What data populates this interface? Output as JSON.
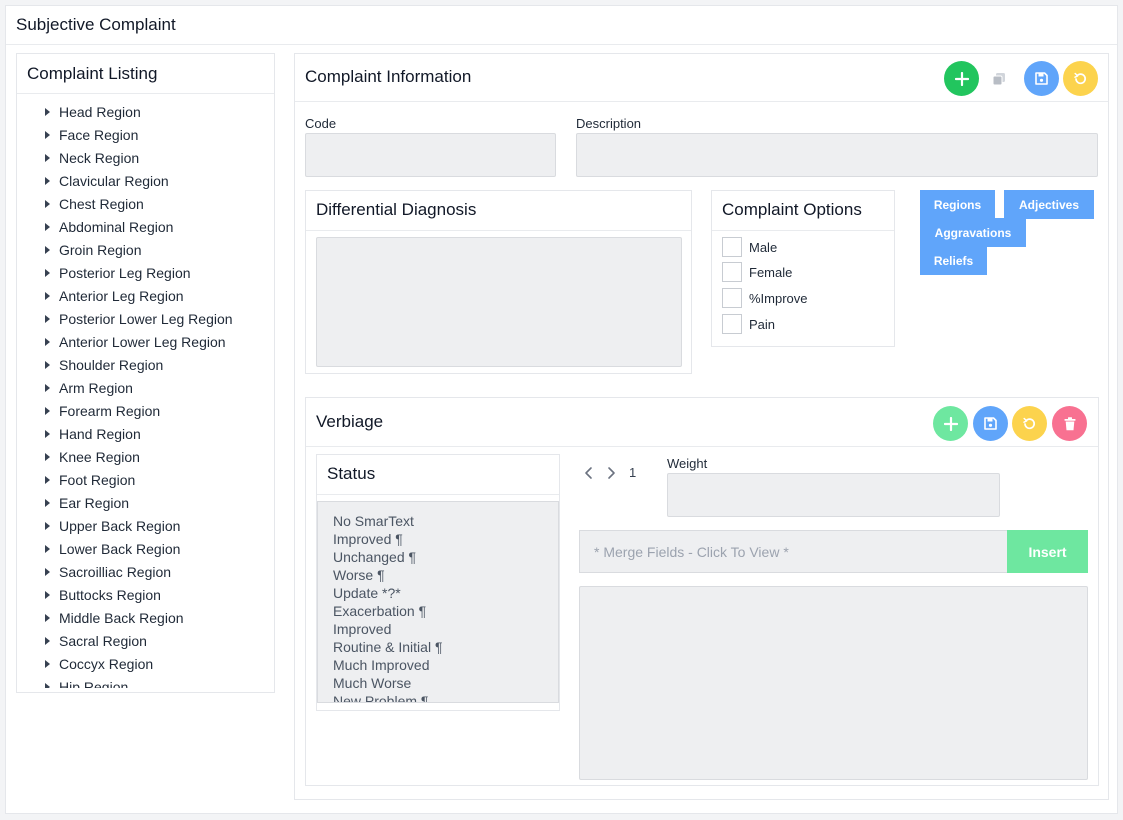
{
  "page": {
    "title": "Subjective Complaint"
  },
  "listing": {
    "title": "Complaint Listing",
    "items": [
      "Head Region",
      "Face Region",
      "Neck Region",
      "Clavicular Region",
      "Chest Region",
      "Abdominal Region",
      "Groin Region",
      "Posterior Leg Region",
      "Anterior Leg Region",
      "Posterior Lower Leg Region",
      "Anterior Lower Leg Region",
      "Shoulder Region",
      "Arm Region",
      "Forearm Region",
      "Hand Region",
      "Knee Region",
      "Foot Region",
      "Ear Region",
      "Upper Back Region",
      "Lower Back Region",
      "Sacroilliac Region",
      "Buttocks Region",
      "Middle Back Region",
      "Sacral Region",
      "Coccyx Region",
      "Hip Region"
    ]
  },
  "info": {
    "title": "Complaint Information",
    "code_label": "Code",
    "code_value": "",
    "description_label": "Description",
    "description_value": ""
  },
  "differential": {
    "title": "Differential Diagnosis",
    "value": ""
  },
  "options": {
    "title": "Complaint Options",
    "items": [
      "Male",
      "Female",
      "%Improve",
      "Pain"
    ]
  },
  "tag_buttons": {
    "regions": "Regions",
    "adjectives": "Adjectives",
    "aggravations": "Aggravations",
    "reliefs": "Reliefs"
  },
  "verbiage": {
    "title": "Verbiage",
    "status_title": "Status",
    "status_items": [
      "No SmarText",
      "Improved ¶",
      "Unchanged ¶",
      "Worse ¶",
      "Update *?*",
      "Exacerbation ¶",
      "Improved",
      "Routine & Initial ¶",
      "Much Improved",
      "Much Worse",
      "New Problem ¶"
    ],
    "page_number": "1",
    "weight_label": "Weight",
    "weight_value": "",
    "merge_placeholder": "* Merge Fields - Click To View *",
    "insert_label": "Insert"
  },
  "colors": {
    "add": "#22c55e",
    "add_light": "#6ee7a0",
    "save": "#60a5fa",
    "undo": "#fcd34d",
    "delete": "#f87191",
    "tag": "#60a5fa"
  }
}
